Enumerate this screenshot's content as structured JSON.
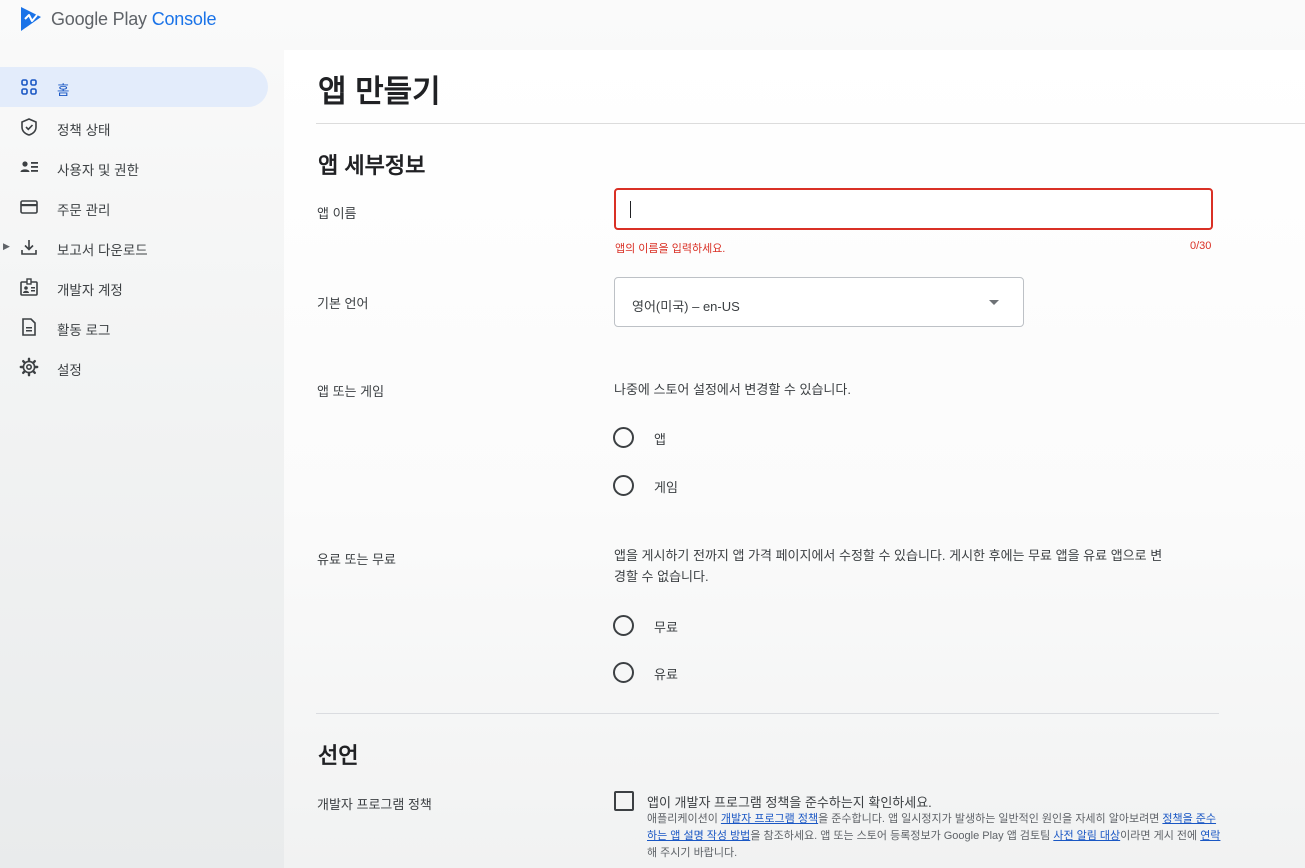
{
  "brand": {
    "google_play": "Google Play",
    "console": "Console"
  },
  "sidebar": {
    "items": [
      {
        "label": "홈",
        "icon": "dashboard-icon",
        "active": true
      },
      {
        "label": "정책 상태",
        "icon": "shield-icon"
      },
      {
        "label": "사용자 및 권한",
        "icon": "users-icon"
      },
      {
        "label": "주문 관리",
        "icon": "credit-card-icon"
      },
      {
        "label": "보고서 다운로드",
        "icon": "download-icon",
        "expandable": true
      },
      {
        "label": "개발자 계정",
        "icon": "badge-icon"
      },
      {
        "label": "활동 로그",
        "icon": "document-icon"
      },
      {
        "label": "설정",
        "icon": "gear-icon"
      }
    ]
  },
  "page": {
    "title": "앱 만들기"
  },
  "details": {
    "title": "앱 세부정보",
    "app_name": {
      "label": "앱 이름",
      "value": "",
      "error": "앱의 이름을 입력하세요.",
      "counter": "0/30"
    },
    "language": {
      "label": "기본 언어",
      "selected": "영어(미국) – en-US"
    },
    "app_or_game": {
      "label": "앱 또는 게임",
      "helper": "나중에 스토어 설정에서 변경할 수 있습니다.",
      "options": [
        "앱",
        "게임"
      ]
    },
    "free_or_paid": {
      "label": "유료 또는 무료",
      "helper_line1": "앱을 게시하기 전까지 앱 가격 페이지에서 수정할 수 있습니다. 게시한 후에는 무료 앱을 유료 앱으로 변",
      "helper_line2": "경할 수 없습니다.",
      "options": [
        "무료",
        "유료"
      ]
    }
  },
  "declarations": {
    "title": "선언",
    "policy": {
      "label": "개발자 프로그램 정책",
      "checkbox_label": "앱이 개발자 프로그램 정책을 준수하는지 확인하세요.",
      "t1": "애플리케이션이 ",
      "link1": "개발자 프로그램 정책",
      "t2": "을 준수합니다. 앱 일시정지가 발생하는 일반적인 원인을 자세히 알아보려면 ",
      "link2": "정책을 준수하는 앱 설명 작성 방법",
      "t3": "을 참조하세요. 앱 또는 스토어 등록정보가 Google Play 앱 검토팀 ",
      "link3": "사전 알림 대상",
      "t4": "이라면 게시 전에 ",
      "link4": "연락",
      "t5": "해 주시기 바랍니다."
    }
  }
}
